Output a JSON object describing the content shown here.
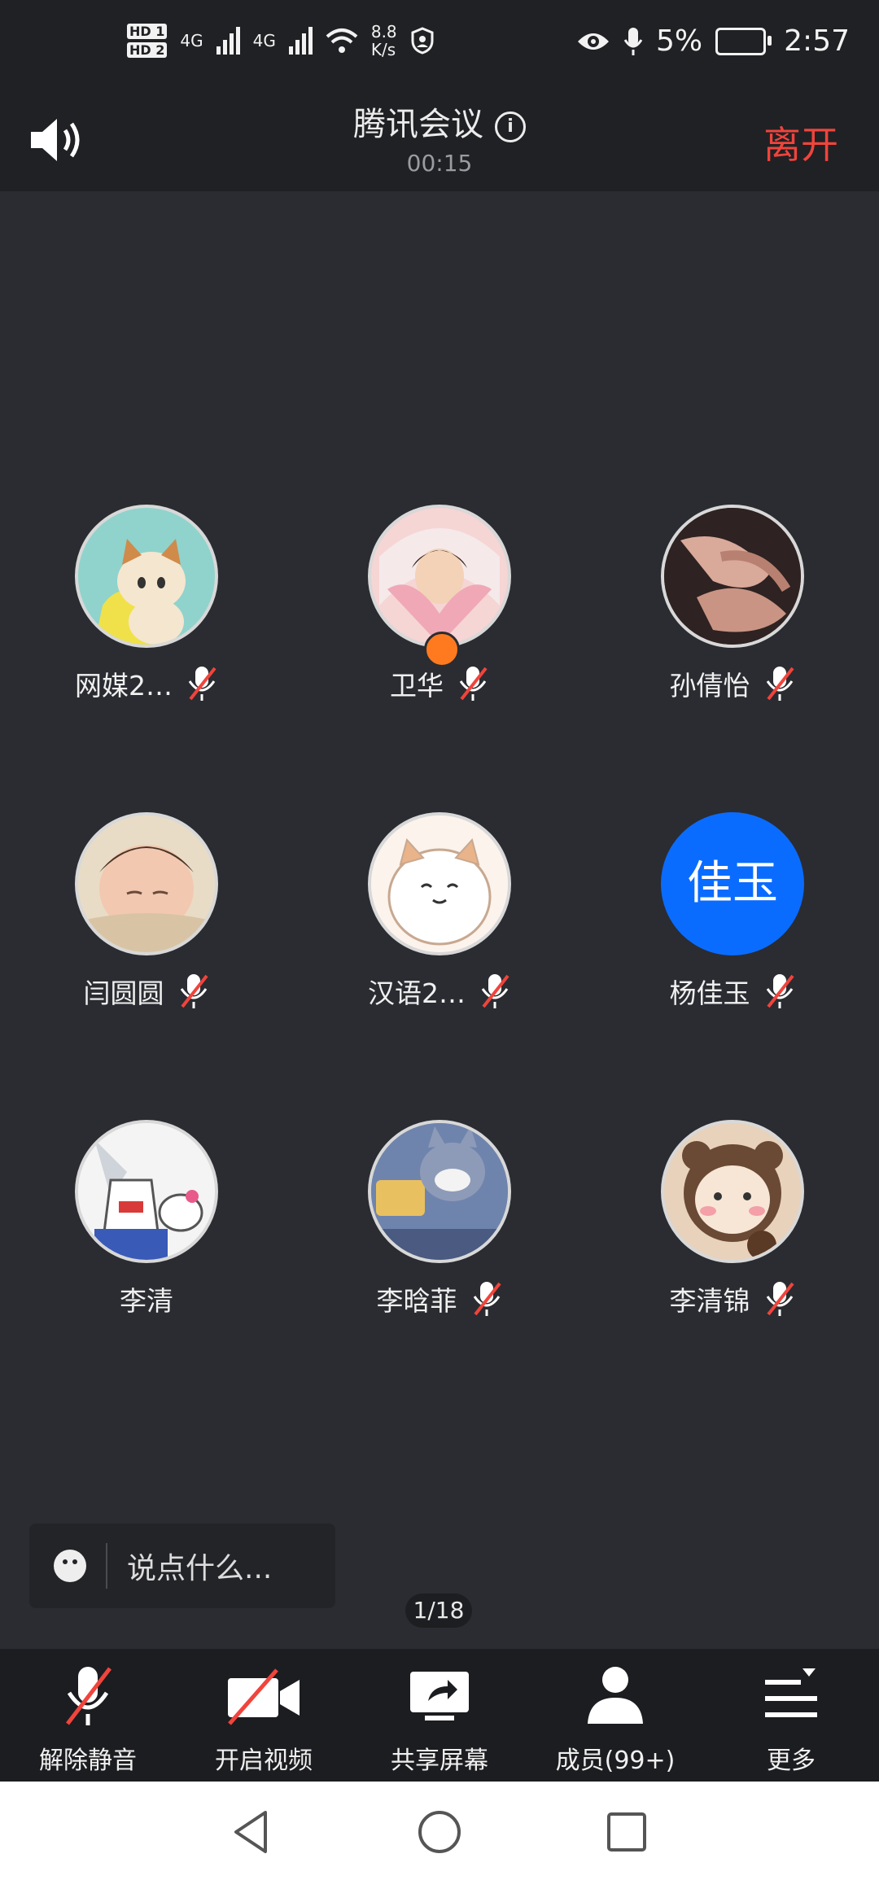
{
  "status_bar": {
    "hd1": "HD 1",
    "hd2": "HD 2",
    "net1": "4G",
    "net2": "4G",
    "speed_value": "8.8",
    "speed_unit": "K/s",
    "battery": "5%",
    "time": "2:57",
    "icons": [
      "signal-icon",
      "wifi-icon",
      "shield-icon",
      "eye-icon",
      "mic-icon",
      "battery-charging-icon"
    ]
  },
  "header": {
    "title": "腾讯会议",
    "info_icon": "i",
    "timer": "00:15",
    "leave": "离开",
    "leave_color": "#f0443c"
  },
  "participants": [
    {
      "name": "网媒2…",
      "muted": true
    },
    {
      "name": "卫华",
      "muted": true,
      "host": true
    },
    {
      "name": "孙倩怡",
      "muted": true
    },
    {
      "name": "闫圆圆",
      "muted": true
    },
    {
      "name": "汉语2…",
      "muted": true
    },
    {
      "name": "杨佳玉",
      "muted": true,
      "avatar_text": "佳玉",
      "avatar_color": "#0a6cff"
    },
    {
      "name": "李清",
      "muted": false
    },
    {
      "name": "李晗菲",
      "muted": true
    },
    {
      "name": "李清锦",
      "muted": true
    }
  ],
  "chat": {
    "placeholder": "说点什么..."
  },
  "pager": "1/18",
  "toolbar": {
    "unmute": "解除静音",
    "video": "开启视频",
    "share": "共享屏幕",
    "members": "成员(99+)",
    "more": "更多"
  }
}
